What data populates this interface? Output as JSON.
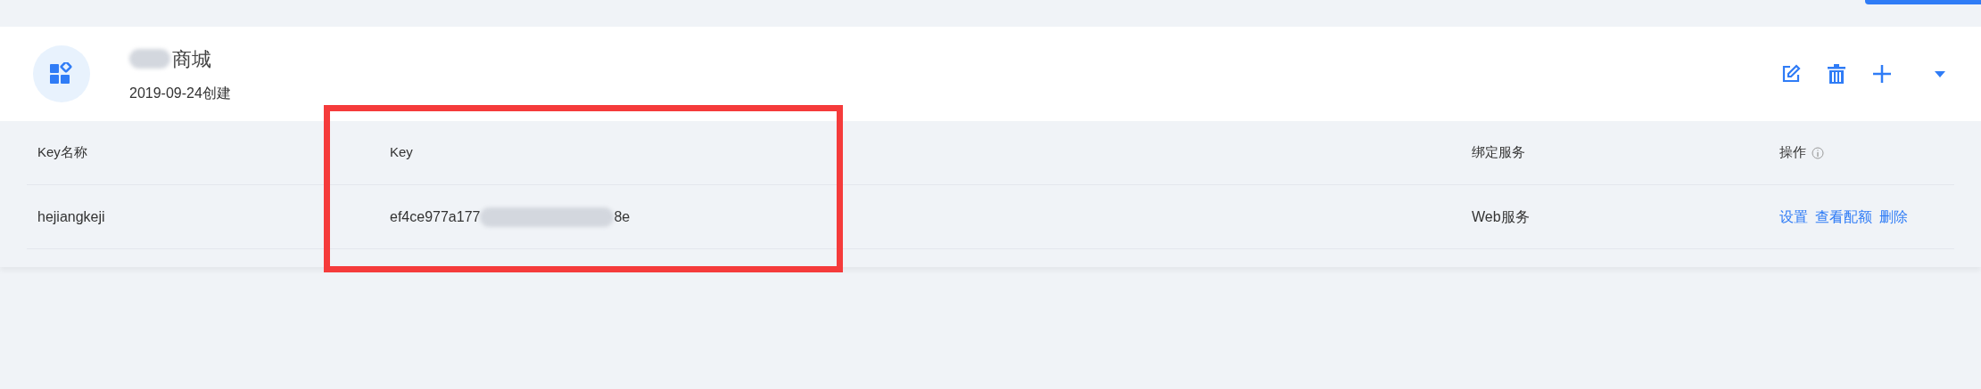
{
  "app": {
    "title": "商城",
    "created": "2019-09-24创建"
  },
  "table": {
    "columns": [
      "Key名称",
      "Key",
      "绑定服务",
      "操作"
    ],
    "rows": [
      {
        "name": "hejiangkeji",
        "key_start": "ef4ce977a177",
        "key_end": "8e",
        "service": "Web服务",
        "actions": [
          "设置",
          "查看配额",
          "删除"
        ]
      }
    ]
  }
}
